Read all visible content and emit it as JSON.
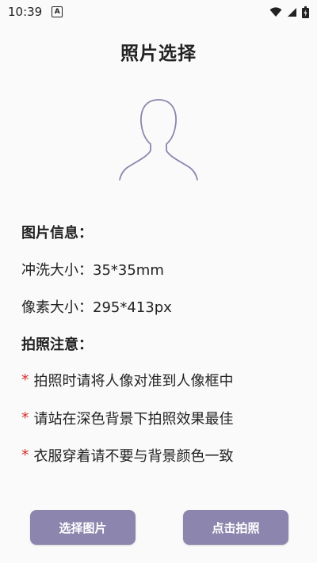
{
  "status_bar": {
    "time": "10:39",
    "notification_icon": "a-badge-icon",
    "icons": [
      "wifi-icon",
      "signal-icon",
      "battery-charging-icon"
    ]
  },
  "page": {
    "title": "照片选择"
  },
  "avatar": {
    "icon": "person-silhouette-icon"
  },
  "photo_info": {
    "heading": "图片信息：",
    "print_size_label": "冲洗大小：",
    "print_size_value": "35*35mm",
    "pixel_size_label": "像素大小：",
    "pixel_size_value": "295*413px"
  },
  "notes": {
    "heading": "拍照注意：",
    "marker": "*",
    "items": [
      "拍照时请将人像对准到人像框中",
      "请站在深色背景下拍照效果最佳",
      "衣服穿着请不要与背景颜色一致"
    ]
  },
  "buttons": {
    "select_photo": "选择图片",
    "take_photo": "点击拍照"
  },
  "colors": {
    "accent": "#8c85ad",
    "marker": "#d32f2f",
    "background": "#fafafa"
  }
}
